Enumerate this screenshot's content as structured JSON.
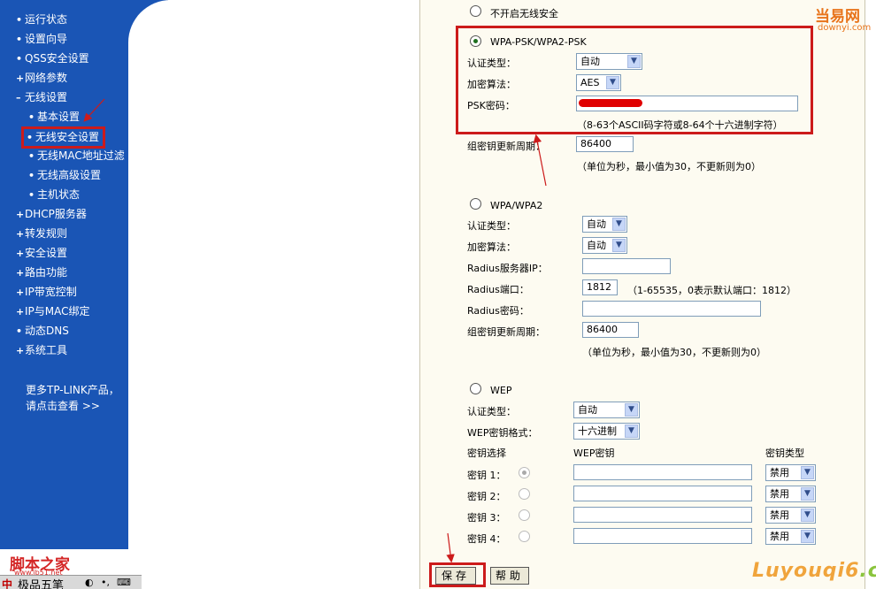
{
  "sidebar": {
    "items": [
      {
        "mark": "•",
        "label": "运行状态"
      },
      {
        "mark": "•",
        "label": "设置向导"
      },
      {
        "mark": "•",
        "label": "QSS安全设置"
      },
      {
        "mark": "+",
        "label": "网络参数"
      },
      {
        "mark": "–",
        "label": "无线设置"
      },
      {
        "mark": "•",
        "label": "基本设置"
      },
      {
        "mark": "•",
        "label": "无线安全设置"
      },
      {
        "mark": "•",
        "label": "无线MAC地址过滤"
      },
      {
        "mark": "•",
        "label": "无线高级设置"
      },
      {
        "mark": "•",
        "label": "主机状态"
      },
      {
        "mark": "+",
        "label": "DHCP服务器"
      },
      {
        "mark": "+",
        "label": "转发规则"
      },
      {
        "mark": "+",
        "label": "安全设置"
      },
      {
        "mark": "+",
        "label": "路由功能"
      },
      {
        "mark": "+",
        "label": "IP带宽控制"
      },
      {
        "mark": "+",
        "label": "IP与MAC绑定"
      },
      {
        "mark": "•",
        "label": "动态DNS"
      },
      {
        "mark": "+",
        "label": "系统工具"
      }
    ],
    "promo_line1": "更多TP-LINK产品，",
    "promo_line2": "请点击查看 >>"
  },
  "form": {
    "no_security_label": "不开启无线安全",
    "wpa_psk": {
      "title": "WPA-PSK/WPA2-PSK",
      "auth_label": "认证类型：",
      "auth_value": "自动",
      "enc_label": "加密算法：",
      "enc_value": "AES",
      "psk_label": "PSK密码：",
      "psk_note": "（8-63个ASCII码字符或8-64个十六进制字符）",
      "renew_label": "组密钥更新周期：",
      "renew_value": "86400",
      "renew_note": "（单位为秒，最小值为30，不更新则为0）"
    },
    "wpa": {
      "title": "WPA/WPA2",
      "auth_label": "认证类型：",
      "auth_value": "自动",
      "enc_label": "加密算法：",
      "enc_value": "自动",
      "radius_ip_label": "Radius服务器IP：",
      "radius_port_label": "Radius端口：",
      "radius_port_value": "1812",
      "radius_port_note": "（1-65535，0表示默认端口：1812）",
      "radius_pw_label": "Radius密码：",
      "renew_label": "组密钥更新周期：",
      "renew_value": "86400",
      "renew_note": "（单位为秒，最小值为30，不更新则为0）"
    },
    "wep": {
      "title": "WEP",
      "auth_label": "认证类型：",
      "auth_value": "自动",
      "format_label": "WEP密钥格式：",
      "format_value": "十六进制",
      "col_select": "密钥选择",
      "col_key": "WEP密钥",
      "col_type": "密钥类型",
      "keys": [
        {
          "label": "密钥 1：",
          "type": "禁用"
        },
        {
          "label": "密钥 2：",
          "type": "禁用"
        },
        {
          "label": "密钥 3：",
          "type": "禁用"
        },
        {
          "label": "密钥 4：",
          "type": "禁用"
        }
      ]
    },
    "save_label": "保存",
    "help_label": "帮助"
  },
  "watermarks": {
    "top_brand": "当易网",
    "top_url": "downyi.com",
    "bottom_brand_a": "Luyouqi6",
    "bottom_brand_b": ".cn",
    "jb_logo": "脚本之家",
    "jb_url": "www.jb51.net"
  },
  "ime": {
    "name": "极品五笔"
  },
  "colors": {
    "sidebar": "#1a55b5",
    "highlight": "#cc1b1b",
    "panel": "#fdfbf1"
  }
}
